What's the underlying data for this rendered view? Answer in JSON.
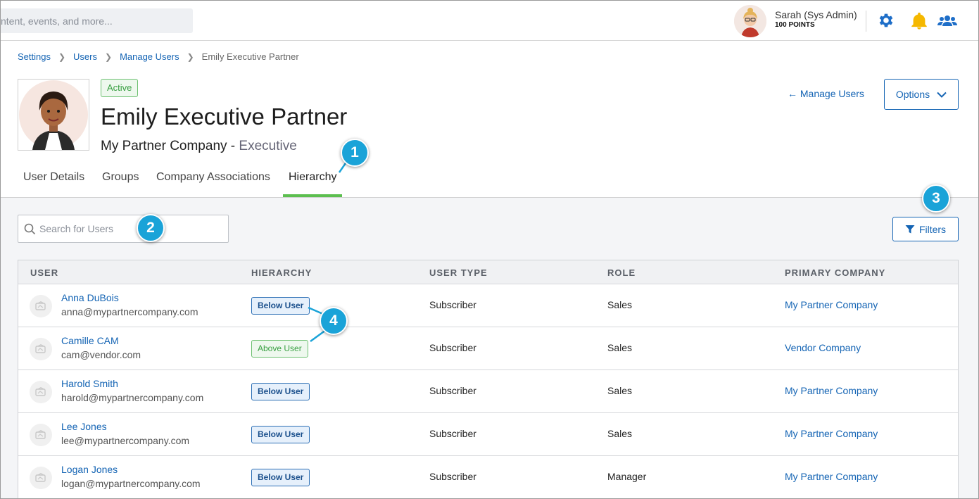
{
  "topbar": {
    "search_placeholder": "ntent, events, and more...",
    "user_name": "Sarah (Sys Admin)",
    "user_points": "100 POINTS",
    "icons": [
      "gear-icon",
      "bell-icon",
      "people-icon"
    ]
  },
  "breadcrumb": {
    "items": [
      "Settings",
      "Users",
      "Manage Users"
    ],
    "current": "Emily Executive Partner"
  },
  "profile": {
    "status": "Active",
    "name": "Emily Executive Partner",
    "company": "My Partner Company - ",
    "role": "Executive"
  },
  "actions": {
    "back_link": "← Manage Users",
    "options_label": "Options"
  },
  "tabs": [
    {
      "label": "User Details"
    },
    {
      "label": "Groups"
    },
    {
      "label": "Company Associations"
    },
    {
      "label": "Hierarchy",
      "active": true
    }
  ],
  "search": {
    "placeholder": "Search for Users"
  },
  "filters_label": "Filters",
  "table": {
    "headers": [
      "USER",
      "HIERARCHY",
      "USER TYPE",
      "ROLE",
      "PRIMARY COMPANY"
    ],
    "rows": [
      {
        "name": "Anna DuBois",
        "email": "anna@mypartnercompany.com",
        "hierarchy": "Below User",
        "user_type": "Subscriber",
        "role": "Sales",
        "company": "My Partner Company"
      },
      {
        "name": "Camille CAM",
        "email": "cam@vendor.com",
        "hierarchy": "Above User",
        "user_type": "Subscriber",
        "role": "Sales",
        "company": "Vendor Company"
      },
      {
        "name": "Harold Smith",
        "email": "harold@mypartnercompany.com",
        "hierarchy": "Below User",
        "user_type": "Subscriber",
        "role": "Sales",
        "company": "My Partner Company"
      },
      {
        "name": "Lee Jones",
        "email": "lee@mypartnercompany.com",
        "hierarchy": "Below User",
        "user_type": "Subscriber",
        "role": "Sales",
        "company": "My Partner Company"
      },
      {
        "name": "Logan Jones",
        "email": "logan@mypartnercompany.com",
        "hierarchy": "Below User",
        "user_type": "Subscriber",
        "role": "Manager",
        "company": "My Partner Company"
      }
    ]
  },
  "callouts": [
    "1",
    "2",
    "3",
    "4"
  ],
  "colors": {
    "accent": "#1464b4",
    "active_tab": "#5cbf4f",
    "callout": "#1aa3d8",
    "badge_green": "#3aa043"
  }
}
